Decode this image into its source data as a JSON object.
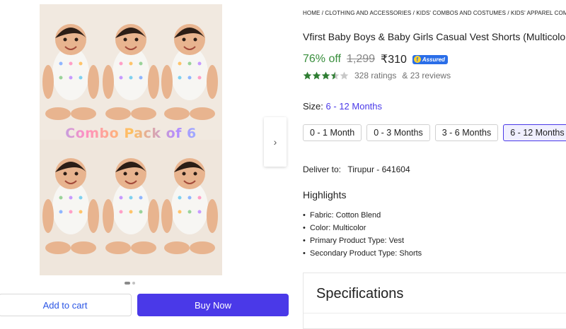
{
  "gallery": {
    "overlay_text": "Combo Pack of 6",
    "next_icon": "chevron-right-icon",
    "colors": {
      "background": "#efe6dc",
      "skin": "#e8b48f",
      "hair": "#2b1d16",
      "vest": "#f7f6f3"
    }
  },
  "actions": {
    "add_to_cart": "Add to cart",
    "buy_now": "Buy Now",
    "buy_color": "#4a39e8"
  },
  "breadcrumb": {
    "items": [
      "HOME",
      "CLOTHING AND ACCESSORIES",
      "KIDS' COMBOS AND COSTUMES",
      "KIDS' APPAREL COMBO"
    ],
    "separator": " / "
  },
  "product": {
    "title": "Vfirst Baby Boys & Baby Girls Casual Vest Shorts (Multicolor)",
    "discount": "76% off",
    "mrp": "1,299",
    "price": "₹310",
    "assured_label": "Assured",
    "rating_value": 3.5,
    "ratings_text": "328 ratings",
    "reviews_text": "& 23 reviews"
  },
  "size": {
    "label": "Size:",
    "selected": "6 - 12 Months",
    "options": [
      "0 - 1 Month",
      "0 - 3 Months",
      "3 - 6 Months",
      "6 - 12 Months"
    ]
  },
  "delivery": {
    "label": "Deliver to:",
    "pincode": "Tirupur - 641604"
  },
  "highlights": {
    "title": "Highlights",
    "items": [
      "Fabric: Cotton Blend",
      "Color: Multicolor",
      "Primary Product Type: Vest",
      "Secondary Product Type: Shorts"
    ]
  },
  "specifications": {
    "title": "Specifications"
  }
}
